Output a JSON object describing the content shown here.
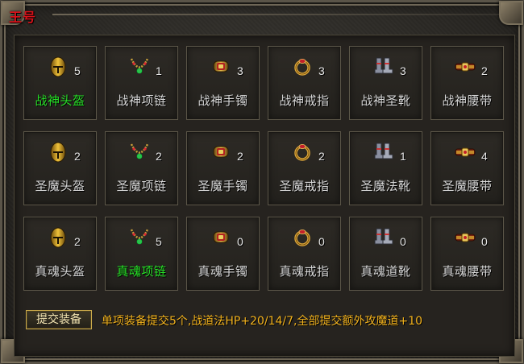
{
  "window": {
    "title": "王号"
  },
  "items": [
    {
      "name": "战神头盔",
      "count": "5",
      "done": true,
      "icon": "helmet-icon"
    },
    {
      "name": "战神项链",
      "count": "1",
      "done": false,
      "icon": "necklace-icon"
    },
    {
      "name": "战神手镯",
      "count": "3",
      "done": false,
      "icon": "bracelet-icon"
    },
    {
      "name": "战神戒指",
      "count": "3",
      "done": false,
      "icon": "ring-icon"
    },
    {
      "name": "战神圣靴",
      "count": "3",
      "done": false,
      "icon": "boots-icon"
    },
    {
      "name": "战神腰带",
      "count": "2",
      "done": false,
      "icon": "belt-icon"
    },
    {
      "name": "圣魔头盔",
      "count": "2",
      "done": false,
      "icon": "helmet-icon"
    },
    {
      "name": "圣魔项链",
      "count": "2",
      "done": false,
      "icon": "necklace-icon"
    },
    {
      "name": "圣魔手镯",
      "count": "2",
      "done": false,
      "icon": "bracelet-icon"
    },
    {
      "name": "圣魔戒指",
      "count": "2",
      "done": false,
      "icon": "ring-icon"
    },
    {
      "name": "圣魔法靴",
      "count": "1",
      "done": false,
      "icon": "boots-icon"
    },
    {
      "name": "圣魔腰带",
      "count": "4",
      "done": false,
      "icon": "belt-icon"
    },
    {
      "name": "真魂头盔",
      "count": "2",
      "done": false,
      "icon": "helmet-icon"
    },
    {
      "name": "真魂项链",
      "count": "5",
      "done": true,
      "icon": "necklace-icon"
    },
    {
      "name": "真魂手镯",
      "count": "0",
      "done": false,
      "icon": "bracelet-icon"
    },
    {
      "name": "真魂戒指",
      "count": "0",
      "done": false,
      "icon": "ring-icon"
    },
    {
      "name": "真魂道靴",
      "count": "0",
      "done": false,
      "icon": "boots-icon"
    },
    {
      "name": "真魂腰带",
      "count": "0",
      "done": false,
      "icon": "belt-icon"
    }
  ],
  "footer": {
    "submit_label": "提交装备",
    "info_text": "单项装备提交5个,战道法HP+20/14/7,全部提交额外攻魔道+10"
  },
  "colors": {
    "done_green": "#27e227",
    "info_orange": "#f2b21d",
    "title_red": "#d8121a"
  }
}
